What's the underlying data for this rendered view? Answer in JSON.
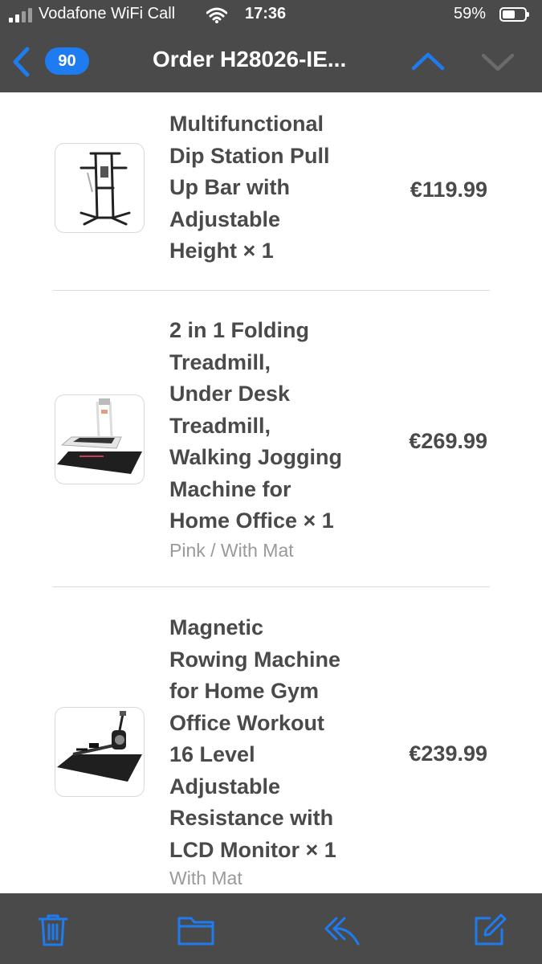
{
  "status_bar": {
    "carrier": "Vodafone WiFi Call",
    "time": "17:36",
    "battery_percent": "59%",
    "battery_level": 0.59
  },
  "nav": {
    "unread_count": "90",
    "title": "Order H28026-IE..."
  },
  "items": [
    {
      "title": "Multifunctional\nDip Station Pull\nUp Bar with\nAdjustable\nHeight × 1",
      "variant": "",
      "price": "€119.99",
      "image_icon": "dip-station-image"
    },
    {
      "title": "2 in 1 Folding\nTreadmill,\nUnder Desk\nTreadmill,\nWalking Jogging\nMachine for\nHome Office × 1",
      "variant": "Pink / With Mat",
      "price": "€269.99",
      "image_icon": "treadmill-image"
    },
    {
      "title": "Magnetic\nRowing Machine\nfor Home Gym\nOffice Workout\n16 Level\nAdjustable\nResistance with\nLCD Monitor × 1",
      "variant": "With Mat",
      "price": "€239.99",
      "image_icon": "rowing-machine-image"
    }
  ],
  "toolbar": {
    "icons": [
      "trash-icon",
      "folder-icon",
      "reply-icon",
      "compose-icon"
    ]
  },
  "colors": {
    "bar_background": "#4a4a4a",
    "accent_blue": "#1e7bf0",
    "text_dark": "#4a4a4a",
    "text_muted": "#9a9a9a"
  }
}
